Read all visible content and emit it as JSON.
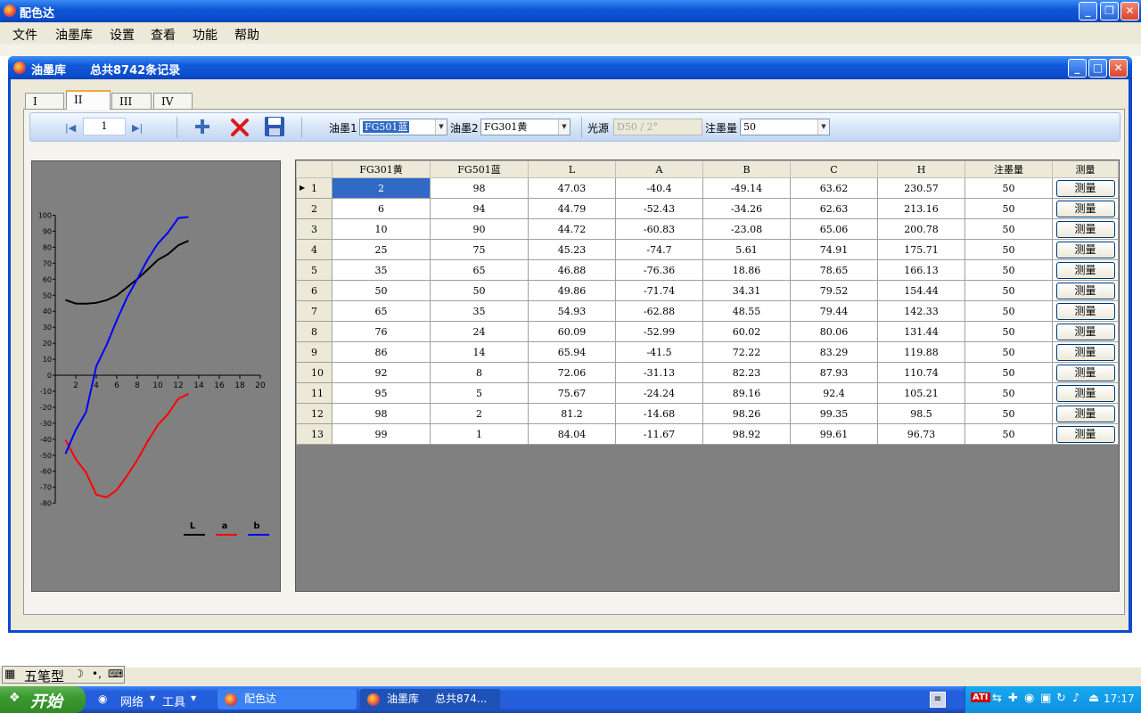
{
  "app": {
    "title": "配色达",
    "menu": [
      "文件",
      "油墨库",
      "设置",
      "查看",
      "功能",
      "帮助"
    ]
  },
  "child": {
    "title": "油墨库",
    "record_count": "总共8742条记录",
    "tabs": [
      "I",
      "II",
      "III",
      "IV"
    ],
    "active_tab": "II"
  },
  "toolbar": {
    "page": "1",
    "ink1_label": "油墨1",
    "ink1_value": "FG501蓝",
    "ink2_label": "油墨2",
    "ink2_value": "FG301黄",
    "light_label": "光源",
    "light_value": "D50 / 2°",
    "inject_label": "注墨量",
    "inject_value": "50"
  },
  "chart_data": {
    "type": "line",
    "x_ticks": [
      "2",
      "4",
      "6",
      "8",
      "10",
      "12",
      "14",
      "16",
      "18",
      "20"
    ],
    "y_ticks": [
      "100",
      "90",
      "80",
      "70",
      "60",
      "50",
      "40",
      "30",
      "20",
      "10",
      "0",
      "-10",
      "-20",
      "-30",
      "-40",
      "-50",
      "-60",
      "-70",
      "-80"
    ],
    "xlim": [
      0,
      20
    ],
    "ylim": [
      -80,
      100
    ],
    "x": [
      1,
      2,
      3,
      4,
      5,
      6,
      7,
      8,
      9,
      10,
      11,
      12,
      13
    ],
    "series": [
      {
        "name": "L",
        "color": "#000000",
        "values": [
          47.03,
          44.79,
          44.72,
          45.23,
          46.88,
          49.86,
          54.93,
          60.09,
          65.94,
          72.06,
          75.67,
          81.2,
          84.04
        ]
      },
      {
        "name": "a",
        "color": "#ff0000",
        "values": [
          -40.4,
          -52.43,
          -60.83,
          -74.7,
          -76.36,
          -71.74,
          -62.88,
          -52.99,
          -41.5,
          -31.13,
          -24.24,
          -14.68,
          -11.67
        ]
      },
      {
        "name": "b",
        "color": "#0000ff",
        "values": [
          -49.14,
          -34.26,
          -23.08,
          5.61,
          18.86,
          34.31,
          48.55,
          60.02,
          72.22,
          82.23,
          89.16,
          98.26,
          98.92
        ]
      }
    ]
  },
  "grid": {
    "columns": [
      "FG301黄",
      "FG501蓝",
      "L",
      "A",
      "B",
      "C",
      "H",
      "注墨量",
      "测量"
    ],
    "rows": [
      [
        "1",
        "2",
        "98",
        "47.03",
        "-40.4",
        "-49.14",
        "63.62",
        "230.57",
        "50",
        "测量"
      ],
      [
        "2",
        "6",
        "94",
        "44.79",
        "-52.43",
        "-34.26",
        "62.63",
        "213.16",
        "50",
        "测量"
      ],
      [
        "3",
        "10",
        "90",
        "44.72",
        "-60.83",
        "-23.08",
        "65.06",
        "200.78",
        "50",
        "测量"
      ],
      [
        "4",
        "25",
        "75",
        "45.23",
        "-74.7",
        "5.61",
        "74.91",
        "175.71",
        "50",
        "测量"
      ],
      [
        "5",
        "35",
        "65",
        "46.88",
        "-76.36",
        "18.86",
        "78.65",
        "166.13",
        "50",
        "测量"
      ],
      [
        "6",
        "50",
        "50",
        "49.86",
        "-71.74",
        "34.31",
        "79.52",
        "154.44",
        "50",
        "测量"
      ],
      [
        "7",
        "65",
        "35",
        "54.93",
        "-62.88",
        "48.55",
        "79.44",
        "142.33",
        "50",
        "测量"
      ],
      [
        "8",
        "76",
        "24",
        "60.09",
        "-52.99",
        "60.02",
        "80.06",
        "131.44",
        "50",
        "测量"
      ],
      [
        "9",
        "86",
        "14",
        "65.94",
        "-41.5",
        "72.22",
        "83.29",
        "119.88",
        "50",
        "测量"
      ],
      [
        "10",
        "92",
        "8",
        "72.06",
        "-31.13",
        "82.23",
        "87.93",
        "110.74",
        "50",
        "测量"
      ],
      [
        "11",
        "95",
        "5",
        "75.67",
        "-24.24",
        "89.16",
        "92.4",
        "105.21",
        "50",
        "测量"
      ],
      [
        "12",
        "98",
        "2",
        "81.2",
        "-14.68",
        "98.26",
        "99.35",
        "98.5",
        "50",
        "测量"
      ],
      [
        "13",
        "99",
        "1",
        "84.04",
        "-11.67",
        "98.92",
        "99.61",
        "96.73",
        "50",
        "测量"
      ]
    ]
  },
  "ime": {
    "label": "五笔型"
  },
  "taskbar": {
    "start": "开始",
    "quick": [
      "网络",
      "工具"
    ],
    "buttons": [
      "配色达",
      "油墨库",
      "总共874..."
    ],
    "clock": "17:17"
  }
}
